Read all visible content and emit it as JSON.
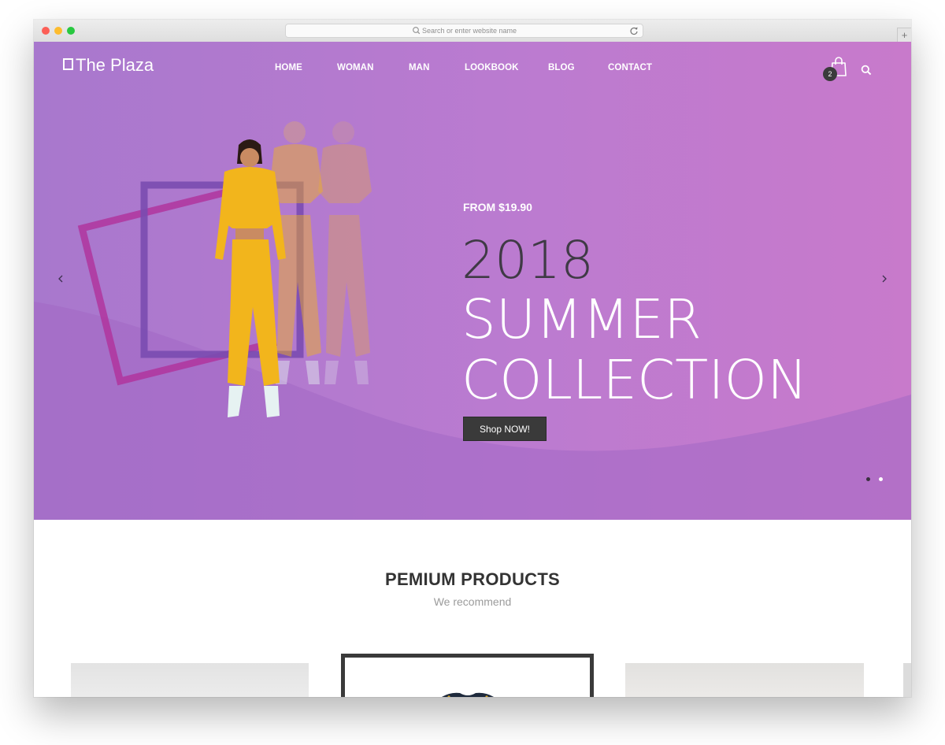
{
  "browser": {
    "url_placeholder": "Search or enter website name",
    "new_tab_label": "+"
  },
  "site": {
    "logo_text": "The Plaza",
    "nav": [
      {
        "label": "HOME"
      },
      {
        "label": "WOMAN"
      },
      {
        "label": "MAN"
      },
      {
        "label": "LOOKBOOK"
      },
      {
        "label": "BLOG"
      },
      {
        "label": "CONTACT"
      }
    ],
    "cart_count": "2"
  },
  "hero": {
    "price_label": "FROM $19.90",
    "year": "2018",
    "line2": "SUMMER",
    "line3": "COLLECTION",
    "button_label": "Shop NOW!",
    "slide_count": 2,
    "active_slide": 1
  },
  "products": {
    "title": "PEMIUM PRODUCTS",
    "subtitle": "We recommend"
  },
  "colors": {
    "hero_gradient_start": "#a878cd",
    "hero_gradient_end": "#c87acb",
    "dark": "#3a3a3a",
    "frame_purple": "#7a4bb0",
    "frame_magenta": "#b0359e",
    "outfit_yellow": "#f2b51c"
  },
  "icons": {
    "search": "search-icon",
    "cart": "shopping-bag-icon",
    "reload": "reload-icon",
    "prev": "chevron-left-icon",
    "next": "chevron-right-icon"
  }
}
